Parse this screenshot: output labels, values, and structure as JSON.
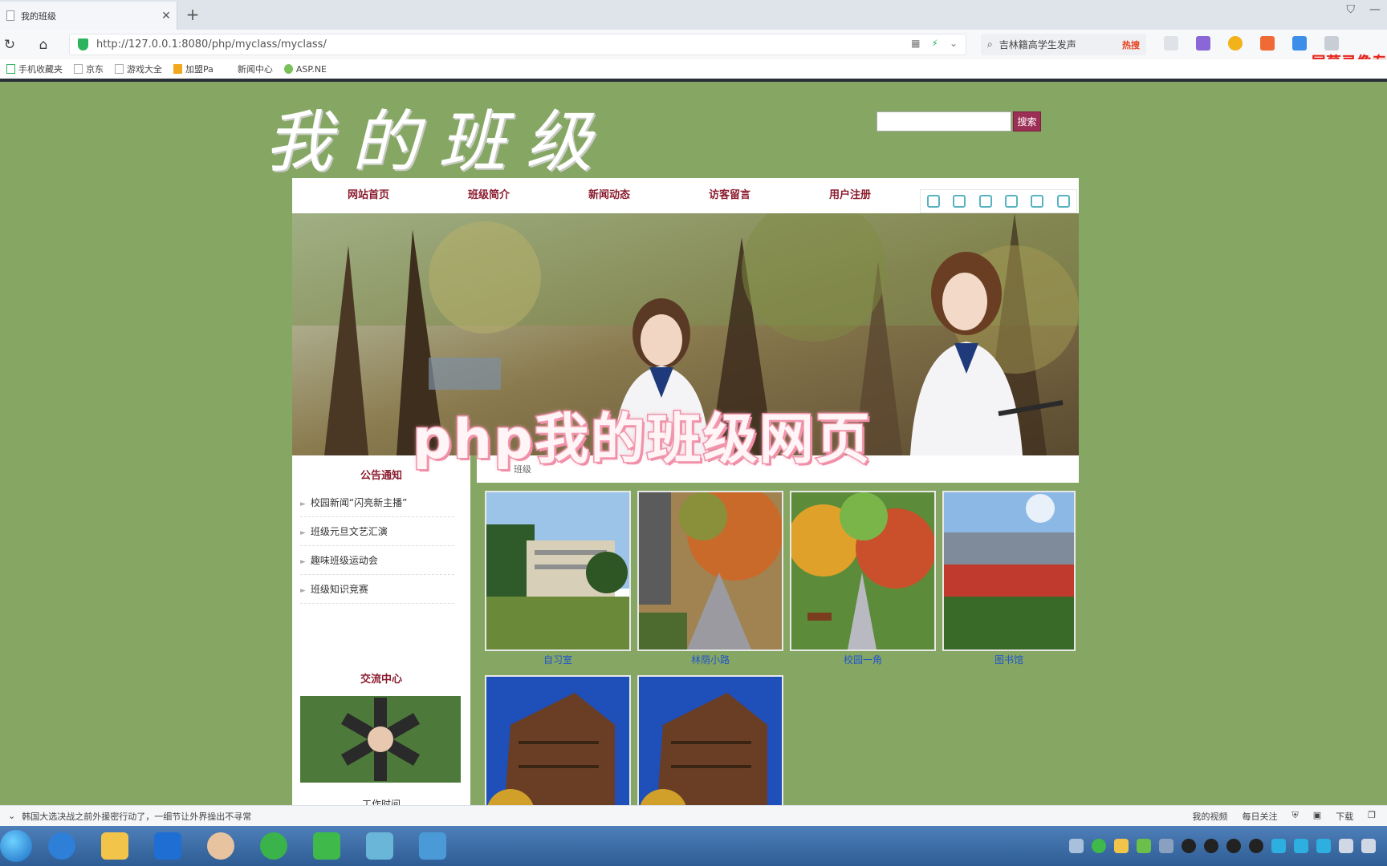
{
  "browser": {
    "tab_title": "我的班级",
    "url": "http://127.0.0.1:8080/php/myclass/myclass/",
    "search_placeholder": "吉林籍高学生发声",
    "hot_label": "热搜",
    "recorder_badge": "屏幕录像专",
    "bookmarks": [
      "手机收藏夹",
      "京东",
      "游戏大全",
      "加盟Pa",
      "新闻中心",
      "ASP.NE"
    ]
  },
  "site": {
    "title": "我的班级",
    "search_button": "搜索",
    "nav": [
      "网站首页",
      "班级简介",
      "新闻动态",
      "访客留言",
      "用户注册"
    ],
    "overlay_caption": "php我的班级网页"
  },
  "notice": {
    "title": "公告通知",
    "items": [
      "校园新闻“闪亮新主播”",
      "班级元旦文艺汇演",
      "趣味班级运动会",
      "班级知识竞赛"
    ]
  },
  "exchange": {
    "title": "交流中心",
    "work_time": "工作时间"
  },
  "gallery": {
    "header": "班级",
    "photos": [
      {
        "caption": "自习室"
      },
      {
        "caption": "林荫小路"
      },
      {
        "caption": "校园一角"
      },
      {
        "caption": "图书馆"
      },
      {
        "caption": ""
      },
      {
        "caption": ""
      }
    ]
  },
  "statusbar": {
    "news": "韩国大选决战之前外援密行动了，一细节让外界操出不寻常",
    "my_video": "我的视频",
    "daily": "每日关注",
    "download": "下载"
  },
  "colors": {
    "page_bg": "#86a764",
    "nav_text": "#8b1c2e",
    "search_button": "#9b2f55",
    "caption_link": "#2255cc"
  }
}
